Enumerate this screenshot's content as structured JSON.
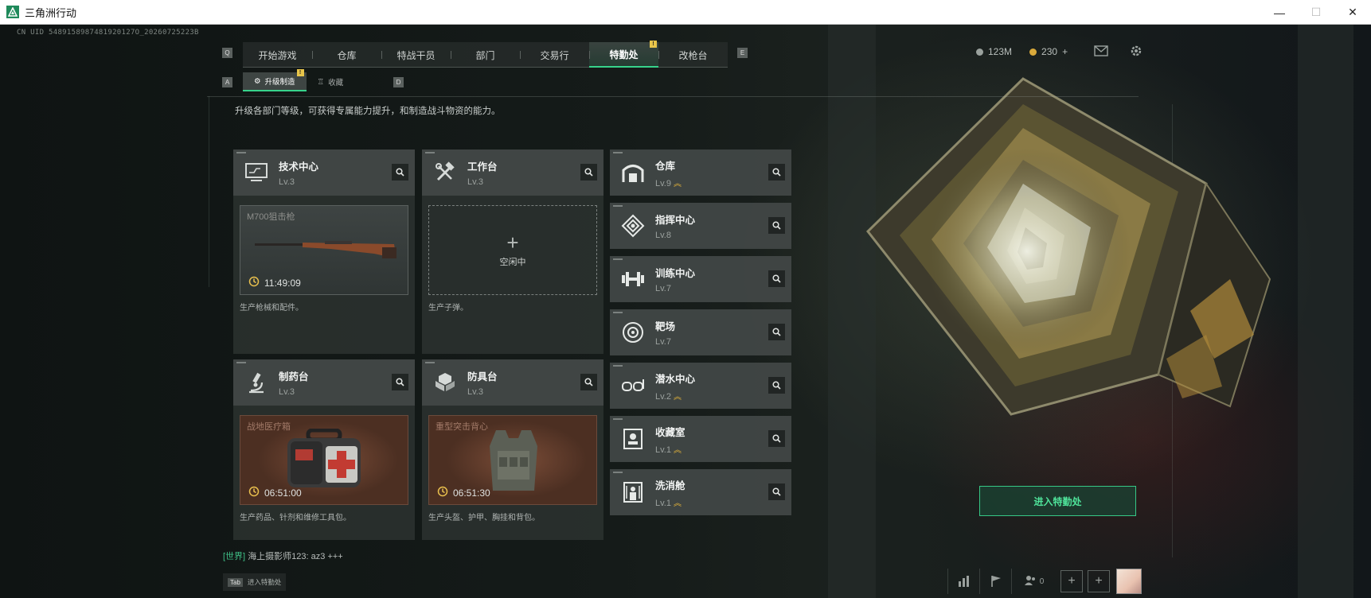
{
  "window": {
    "title": "三角洲行动",
    "controls": {
      "minimize": "—",
      "maximize": "☐",
      "close": "✕"
    }
  },
  "uid_text": "CN UID 5489158987481920127O_20260725223B",
  "nav": {
    "key_left": "Q",
    "key_right": "E",
    "tabs": [
      {
        "label": "开始游戏",
        "active": false
      },
      {
        "label": "仓库",
        "active": false
      },
      {
        "label": "特战干员",
        "active": false
      },
      {
        "label": "部门",
        "active": false
      },
      {
        "label": "交易行",
        "active": false
      },
      {
        "label": "特勤处",
        "active": true,
        "badge": "!"
      },
      {
        "label": "改枪台",
        "active": false
      }
    ]
  },
  "subnav": {
    "key_left": "A",
    "key_right": "D",
    "tabs": [
      {
        "label": "升级制造",
        "active": true,
        "badge": "!"
      },
      {
        "label": "收藏",
        "active": false
      }
    ]
  },
  "intro": "升级各部门等级，可获得专属能力提升，和制造战斗物资的能力。",
  "currency": {
    "coins": "123M",
    "bonds": "230",
    "add": "+"
  },
  "production": [
    {
      "name": "技术中心",
      "level": "Lv.3",
      "icon": "monitor-circuit-icon",
      "slot": {
        "state": "busy",
        "item": "M700狙击枪",
        "timer": "11:49:09",
        "style": "grey"
      },
      "desc": "生产枪械和配件。"
    },
    {
      "name": "工作台",
      "level": "Lv.3",
      "icon": "hammer-wrench-icon",
      "slot": {
        "state": "empty",
        "plus": "+",
        "label": "空闲中"
      },
      "desc": "生产子弹。"
    },
    {
      "name": "制药台",
      "level": "Lv.3",
      "icon": "microscope-icon",
      "slot": {
        "state": "busy",
        "item": "战地医疗箱",
        "timer": "06:51:00",
        "style": "brown"
      },
      "desc": "生产药品、针剂和维修工具包。"
    },
    {
      "name": "防具台",
      "level": "Lv.3",
      "icon": "cubes-icon",
      "slot": {
        "state": "busy",
        "item": "重型突击背心",
        "timer": "06:51:30",
        "style": "brown"
      },
      "desc": "生产头盔、护甲、胸挂和背包。"
    }
  ],
  "departments": [
    {
      "name": "仓库",
      "level": "Lv.9",
      "upgrade": true,
      "icon": "warehouse-icon"
    },
    {
      "name": "指挥中心",
      "level": "Lv.8",
      "upgrade": false,
      "icon": "command-center-icon"
    },
    {
      "name": "训练中心",
      "level": "Lv.7",
      "upgrade": false,
      "icon": "dumbbell-icon"
    },
    {
      "name": "靶场",
      "level": "Lv.7",
      "upgrade": false,
      "icon": "target-icon"
    },
    {
      "name": "潜水中心",
      "level": "Lv.2",
      "upgrade": true,
      "icon": "diving-goggles-icon"
    },
    {
      "name": "收藏室",
      "level": "Lv.1",
      "upgrade": true,
      "icon": "collection-room-icon"
    },
    {
      "name": "洗消舱",
      "level": "Lv.1",
      "upgrade": true,
      "icon": "decon-pod-icon"
    }
  ],
  "upgrade_glyph": "︽",
  "enter_button": "进入特勤处",
  "chat": {
    "channel": "[世界]",
    "message": "海上摄影师123: az3 +++"
  },
  "tab_hint": {
    "key": "Tab",
    "label": "进入特勤处"
  },
  "bottom_bar": {
    "friends_count": "0"
  },
  "colors": {
    "accent_green": "#37d38b",
    "upgrade_gold": "#e5b43a",
    "badge_yellow": "#e8c54a"
  }
}
